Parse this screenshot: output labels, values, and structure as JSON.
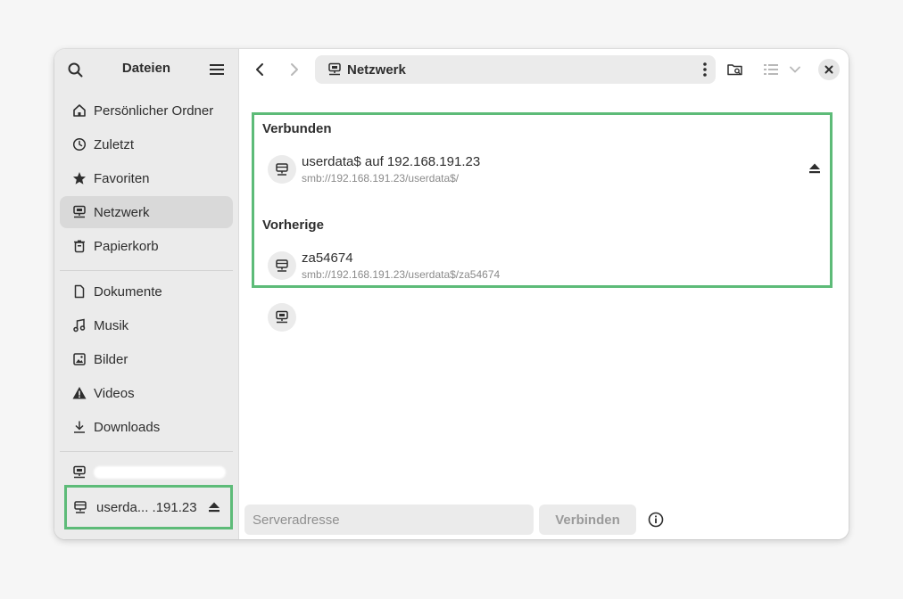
{
  "sidebar": {
    "title": "Dateien",
    "places": [
      {
        "label": "Persönlicher Ordner",
        "icon": "home-icon"
      },
      {
        "label": "Zuletzt",
        "icon": "clock-icon"
      },
      {
        "label": "Favoriten",
        "icon": "star-icon"
      },
      {
        "label": "Netzwerk",
        "icon": "network-icon",
        "active": true
      },
      {
        "label": "Papierkorb",
        "icon": "trash-icon"
      }
    ],
    "bookmarks": [
      {
        "label": "Dokumente",
        "icon": "document-icon"
      },
      {
        "label": "Musik",
        "icon": "music-icon"
      },
      {
        "label": "Bilder",
        "icon": "image-icon"
      },
      {
        "label": "Videos",
        "icon": "warning-icon"
      },
      {
        "label": "Downloads",
        "icon": "download-icon"
      }
    ],
    "mount": {
      "label": "userda... .191.23",
      "icon": "network-drive-icon"
    }
  },
  "header": {
    "location": "Netzwerk"
  },
  "sections": {
    "connected": {
      "title": "Verbunden",
      "items": [
        {
          "name": "userdata$ auf 192.168.191.23",
          "uri": "smb://192.168.191.23/userdata$/"
        }
      ]
    },
    "previous": {
      "title": "Vorherige",
      "items": [
        {
          "name": "za54674",
          "uri": "smb://192.168.191.23/userdata$/za54674"
        }
      ]
    }
  },
  "bottom": {
    "server_placeholder": "Serveradresse",
    "connect_label": "Verbinden"
  },
  "colors": {
    "highlight": "#5dbb78",
    "sidebar_bg": "#ebebeb"
  }
}
